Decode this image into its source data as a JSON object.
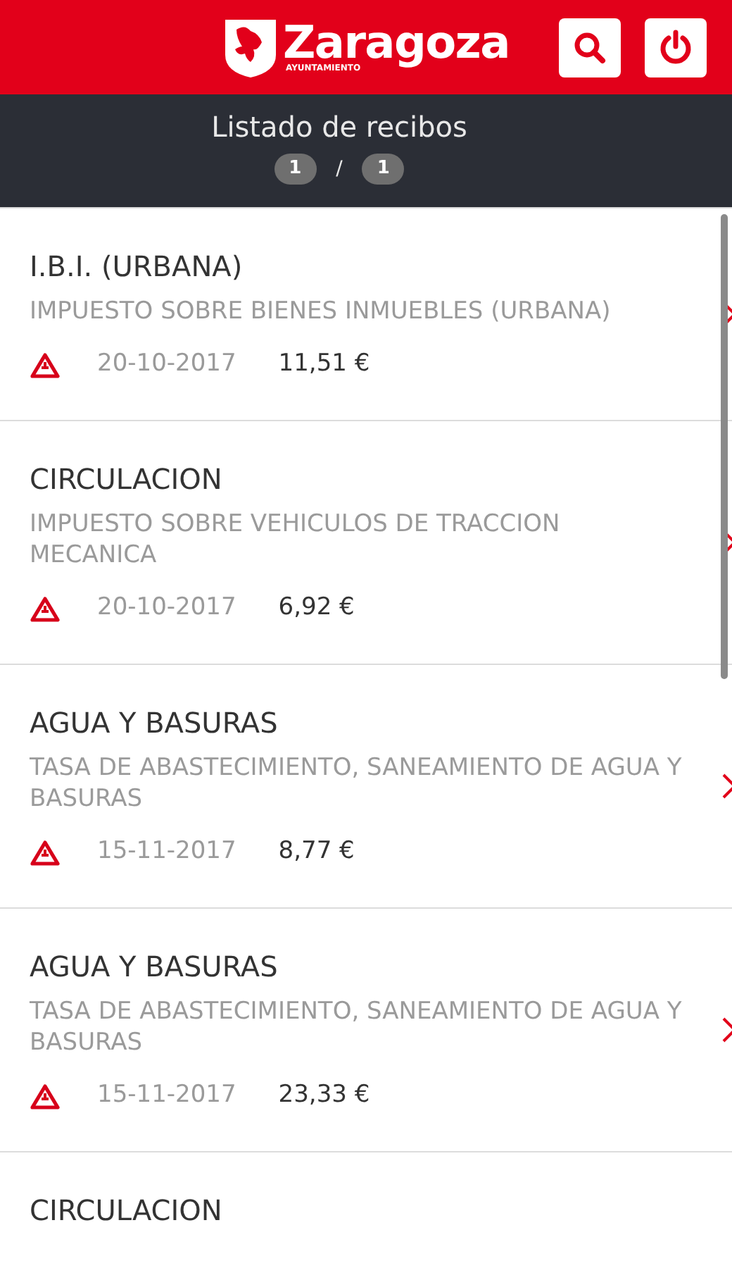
{
  "header": {
    "logo_text": "Zaragoza",
    "logo_subtext": "AYUNTAMIENTO"
  },
  "toolbar": {
    "title": "Listado de recibos",
    "page": "1",
    "separator": "/",
    "total_pages": "1"
  },
  "receipts": [
    {
      "title": "I.B.I. (URBANA)",
      "description": "IMPUESTO SOBRE BIENES INMUEBLES (URBANA)",
      "date": "20-10-2017",
      "amount": "11,51 €",
      "warning": true
    },
    {
      "title": "CIRCULACION",
      "description": "IMPUESTO SOBRE VEHICULOS DE TRACCION MECANICA",
      "date": "20-10-2017",
      "amount": "6,92 €",
      "warning": true
    },
    {
      "title": "AGUA Y BASURAS",
      "description": "TASA DE ABASTECIMIENTO, SANEAMIENTO DE AGUA Y BASURAS",
      "date": "15-11-2017",
      "amount": "8,77 €",
      "warning": true
    },
    {
      "title": "AGUA Y BASURAS",
      "description": "TASA DE ABASTECIMIENTO, SANEAMIENTO DE AGUA Y BASURAS",
      "date": "15-11-2017",
      "amount": "23,33 €",
      "warning": true
    },
    {
      "title": "CIRCULACION"
    }
  ]
}
